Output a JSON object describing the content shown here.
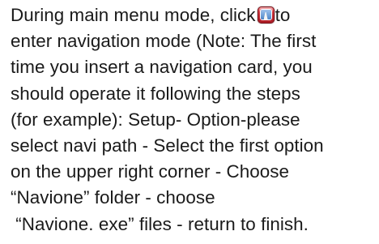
{
  "paragraph": {
    "line1_before_icon": "During main menu mode, click",
    "line1_after_icon": "to",
    "line2": "enter navigation mode (Note: The first",
    "line3": "time you insert a navigation card, you",
    "line4": "should operate it following the steps",
    "line5": "(for example): Setup- Option-please",
    "line6": "select navi path - Select the first option",
    "line7": "on the upper right corner - Choose",
    "line8": "“Navione” folder - choose",
    "line9": " “Navione. exe” files - return to finish."
  },
  "icon": {
    "name": "navigation-icon",
    "color": "#c42a33"
  }
}
